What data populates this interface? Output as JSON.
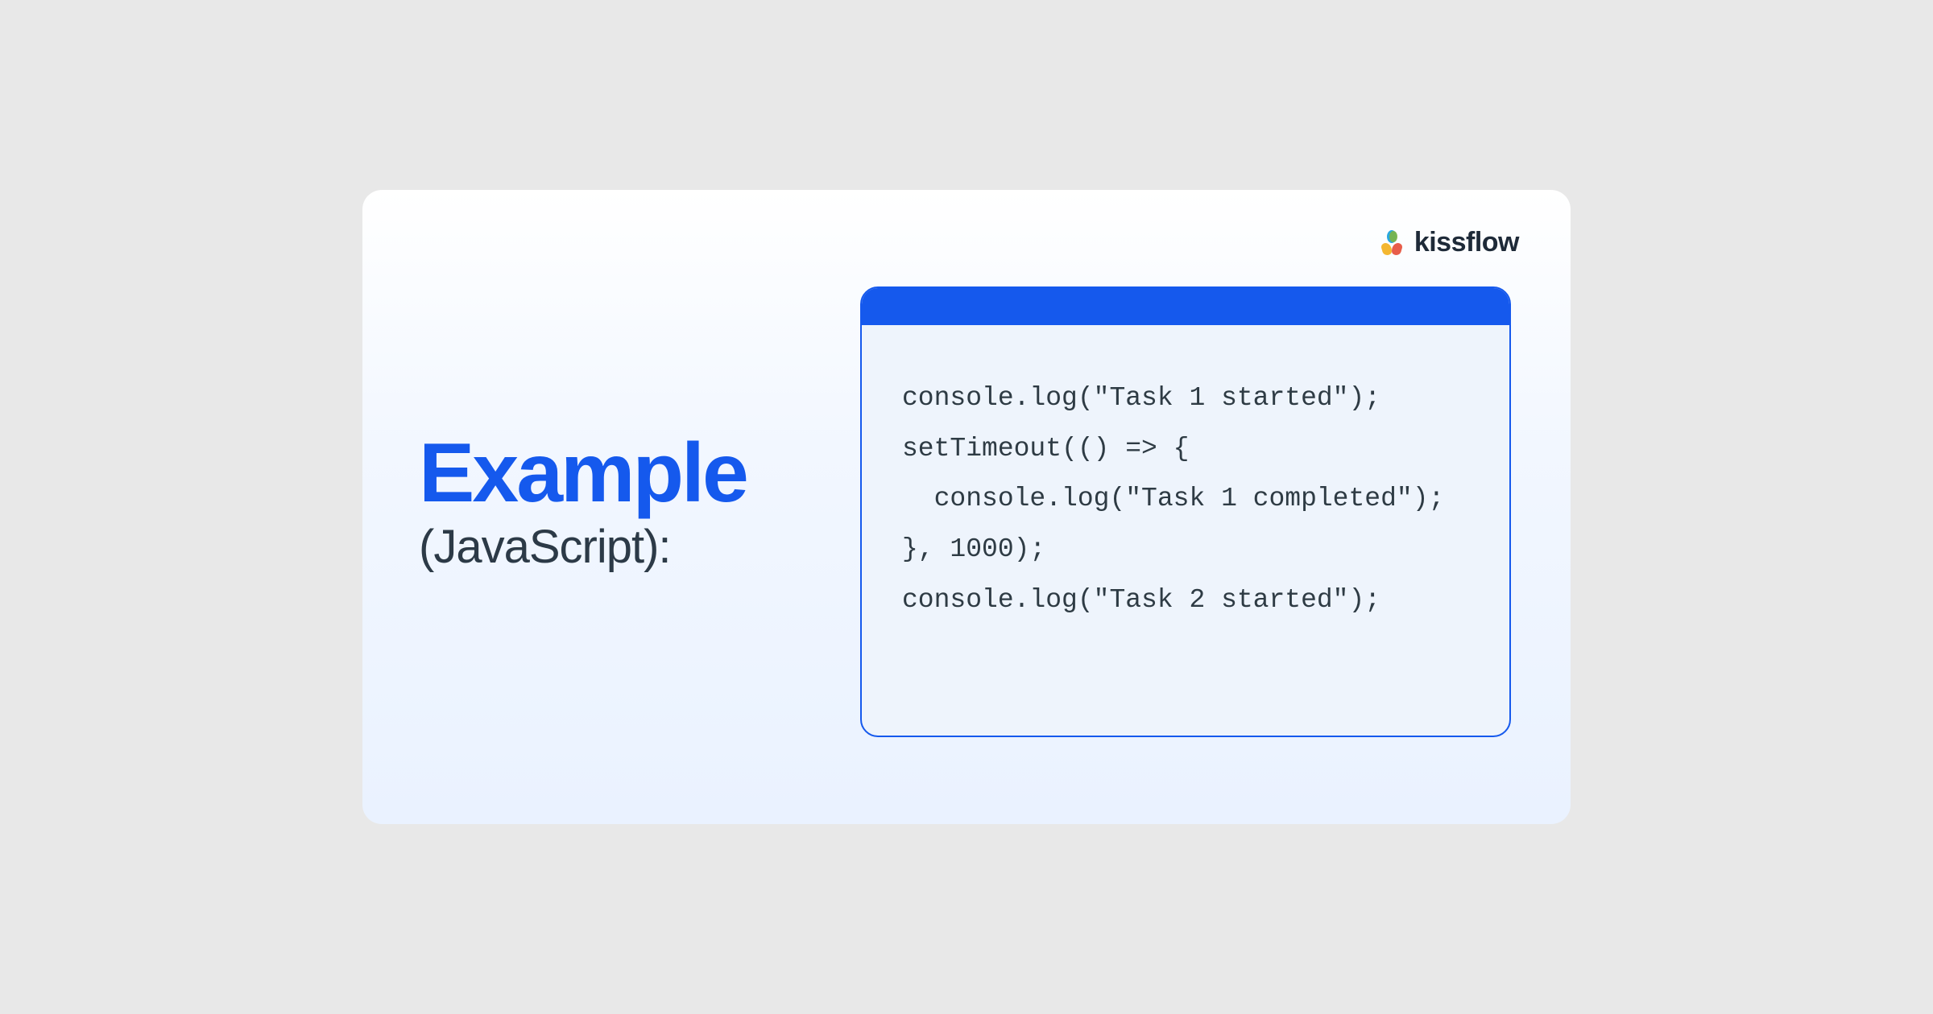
{
  "brand": {
    "name": "kissflow"
  },
  "heading": {
    "title": "Example",
    "subtitle": "(JavaScript):"
  },
  "code": {
    "lines": [
      "console.log(\"Task 1 started\");",
      "setTimeout(() => {",
      "  console.log(\"Task 1 completed\");",
      "}, 1000);",
      "console.log(\"Task 2 started\");"
    ]
  }
}
